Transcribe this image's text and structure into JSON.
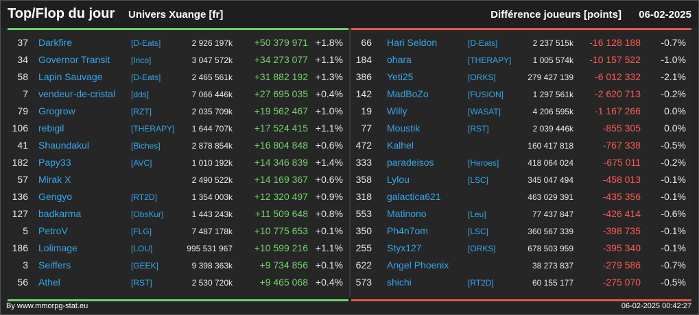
{
  "header": {
    "title": "Top/Flop du jour",
    "universe": "Univers Xuange [fr]",
    "diff_label": "Différence joueurs [points]",
    "date": "06-02-2025"
  },
  "colors": {
    "top_accent": "#6bd26b",
    "flop_accent": "#e05a4e",
    "link": "#35a8ea"
  },
  "top": [
    {
      "rank": "37",
      "name": "Darkfire",
      "guild": "[D-Eats]",
      "points": "2 926 197k",
      "diff": "+50 379 971",
      "pct": "+1.8%"
    },
    {
      "rank": "34",
      "name": "Governor Transit",
      "guild": "[Inco]",
      "points": "3 047 572k",
      "diff": "+34 273 077",
      "pct": "+1.1%"
    },
    {
      "rank": "58",
      "name": "Lapin Sauvage",
      "guild": "[D-Eats]",
      "points": "2 465 561k",
      "diff": "+31 882 192",
      "pct": "+1.3%"
    },
    {
      "rank": "7",
      "name": "vendeur-de-cristal",
      "guild": "[dds]",
      "points": "7 066 446k",
      "diff": "+27 695 035",
      "pct": "+0.4%"
    },
    {
      "rank": "79",
      "name": "Grogrow",
      "guild": "[RZT]",
      "points": "2 035 709k",
      "diff": "+19 562 467",
      "pct": "+1.0%"
    },
    {
      "rank": "106",
      "name": "rebigil",
      "guild": "[THERAPY]",
      "points": "1 644 707k",
      "diff": "+17 524 415",
      "pct": "+1.1%"
    },
    {
      "rank": "41",
      "name": "Shaundakul",
      "guild": "[Biches]",
      "points": "2 878 854k",
      "diff": "+16 804 848",
      "pct": "+0.6%"
    },
    {
      "rank": "182",
      "name": "Papy33",
      "guild": "[AVC]",
      "points": "1 010 192k",
      "diff": "+14 346 839",
      "pct": "+1.4%"
    },
    {
      "rank": "57",
      "name": "Mirak X",
      "guild": "",
      "points": "2 490 522k",
      "diff": "+14 169 367",
      "pct": "+0.6%"
    },
    {
      "rank": "136",
      "name": "Gengyo",
      "guild": "[RT2D]",
      "points": "1 354 003k",
      "diff": "+12 320 497",
      "pct": "+0.9%"
    },
    {
      "rank": "127",
      "name": "badkarma",
      "guild": "[ObsKur]",
      "points": "1 443 243k",
      "diff": "+11 509 648",
      "pct": "+0.8%"
    },
    {
      "rank": "5",
      "name": "PetroV",
      "guild": "[FLG]",
      "points": "7 487 178k",
      "diff": "+10 775 653",
      "pct": "+0.1%"
    },
    {
      "rank": "186",
      "name": "Lolimage",
      "guild": "[LOU]",
      "points": "995 531 967",
      "diff": "+10 599 216",
      "pct": "+1.1%"
    },
    {
      "rank": "3",
      "name": "Seiffers",
      "guild": "[GEEK]",
      "points": "9 398 363k",
      "diff": "+9 734 856",
      "pct": "+0.1%"
    },
    {
      "rank": "56",
      "name": "Athel",
      "guild": "[RST]",
      "points": "2 530 720k",
      "diff": "+9 465 068",
      "pct": "+0.4%"
    }
  ],
  "flop": [
    {
      "rank": "66",
      "name": "Hari Seldon",
      "guild": "[D-Eats]",
      "points": "2 237 515k",
      "diff": "-16 128 188",
      "pct": "-0.7%"
    },
    {
      "rank": "184",
      "name": "ohara",
      "guild": "[THERAPY]",
      "points": "1 005 574k",
      "diff": "-10 157 522",
      "pct": "-1.0%"
    },
    {
      "rank": "386",
      "name": "Yeti25",
      "guild": "[ORKS]",
      "points": "279 427 139",
      "diff": "-6 012 332",
      "pct": "-2.1%"
    },
    {
      "rank": "142",
      "name": "MadBoZo",
      "guild": "[FUSION]",
      "points": "1 297 561k",
      "diff": "-2 620 713",
      "pct": "-0.2%"
    },
    {
      "rank": "19",
      "name": "Willy",
      "guild": "[WASAT]",
      "points": "4 206 595k",
      "diff": "-1 167 266",
      "pct": "0.0%"
    },
    {
      "rank": "77",
      "name": "Moustik",
      "guild": "[RST]",
      "points": "2 039 446k",
      "diff": "-855 305",
      "pct": "0.0%"
    },
    {
      "rank": "472",
      "name": "Kalhel",
      "guild": "",
      "points": "160 417 818",
      "diff": "-767 338",
      "pct": "-0.5%"
    },
    {
      "rank": "333",
      "name": "paradeisos",
      "guild": "[Heroes]",
      "points": "418 064 024",
      "diff": "-675 011",
      "pct": "-0.2%"
    },
    {
      "rank": "358",
      "name": "Lylou",
      "guild": "[LSC]",
      "points": "345 047 494",
      "diff": "-458 013",
      "pct": "-0.1%"
    },
    {
      "rank": "318",
      "name": "galactica621",
      "guild": "",
      "points": "463 029 391",
      "diff": "-435 356",
      "pct": "-0.1%"
    },
    {
      "rank": "553",
      "name": "Matinono",
      "guild": "[Leu]",
      "points": "77 437 847",
      "diff": "-426 414",
      "pct": "-0.6%"
    },
    {
      "rank": "350",
      "name": "Ph4n7om",
      "guild": "[LSC]",
      "points": "360 567 339",
      "diff": "-398 735",
      "pct": "-0.1%"
    },
    {
      "rank": "255",
      "name": "Styx127",
      "guild": "[ORKS]",
      "points": "678 503 959",
      "diff": "-395 340",
      "pct": "-0.1%"
    },
    {
      "rank": "622",
      "name": "Angel Phoenix",
      "guild": "",
      "points": "38 273 837",
      "diff": "-279 586",
      "pct": "-0.7%"
    },
    {
      "rank": "573",
      "name": "shichi",
      "guild": "[RT2D]",
      "points": "60 155 177",
      "diff": "-275 070",
      "pct": "-0.5%"
    }
  ],
  "footer": {
    "credit": "By www.mmorpg-stat.eu",
    "timestamp": "06-02-2025 00:42:27"
  }
}
